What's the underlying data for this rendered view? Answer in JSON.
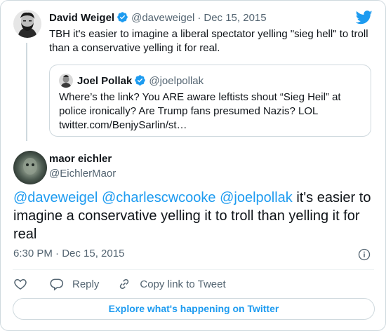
{
  "colors": {
    "accent": "#1d9bf0",
    "text": "#0f1419",
    "secondary": "#536471",
    "border": "#cfd9de"
  },
  "parent_tweet": {
    "name": "David Weigel",
    "handle": "@daveweigel",
    "sep": "·",
    "date": "Dec 15, 2015",
    "text": "TBH it's easier to imagine a liberal spectator yelling \"sieg hell\" to troll than a conservative yelling it for real.",
    "avatar_icon": "bearded-man-avatar"
  },
  "quoted_tweet": {
    "name": "Joel Pollak",
    "handle": "@joelpollak",
    "text": "Where’s the link? You ARE aware leftists shout “Sieg Heil” at police ironically? Are Trump fans presumed Nazis? LOL twitter.com/BenjySarlin/st…"
  },
  "main_tweet": {
    "name": "maor eichler",
    "handle": "@EichlerMaor",
    "mentions": [
      "@daveweigel",
      "@charlescwcooke",
      "@joelpollak"
    ],
    "text": "it's easier to imagine a conservative yelling it to troll than yelling it for real",
    "time": "6:30 PM · Dec 15, 2015"
  },
  "actions": {
    "like_icon": "heart-icon",
    "reply_label": "Reply",
    "copy_label": "Copy link to Tweet"
  },
  "explore_label": "Explore what's happening on Twitter"
}
